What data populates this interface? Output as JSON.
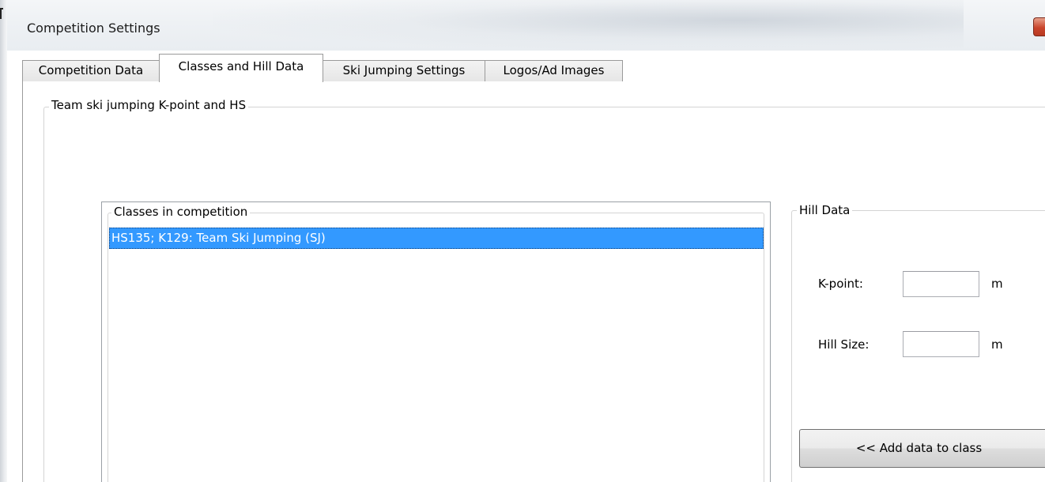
{
  "window": {
    "title": "Competition Settings"
  },
  "tabs": [
    {
      "label": "Competition Data",
      "active": false
    },
    {
      "label": "Classes and Hill Data",
      "active": true
    },
    {
      "label": "Ski Jumping Settings",
      "active": false
    },
    {
      "label": "Logos/Ad Images",
      "active": false
    }
  ],
  "team_group": {
    "label": "Team ski jumping K-point and HS"
  },
  "classes": {
    "label": "Classes in competition",
    "items": [
      {
        "text": "HS135; K129: Team Ski Jumping (SJ)",
        "selected": true
      }
    ]
  },
  "hill_data": {
    "label": "Hill Data",
    "kpoint_label": "K-point:",
    "kpoint_value": "",
    "kpoint_unit": "m",
    "hillsize_label": "Hill Size:",
    "hillsize_value": "",
    "hillsize_unit": "m",
    "add_button_label": "<< Add data to class"
  },
  "colors": {
    "selection": "#3399ff",
    "close_button": "#c9452c"
  }
}
